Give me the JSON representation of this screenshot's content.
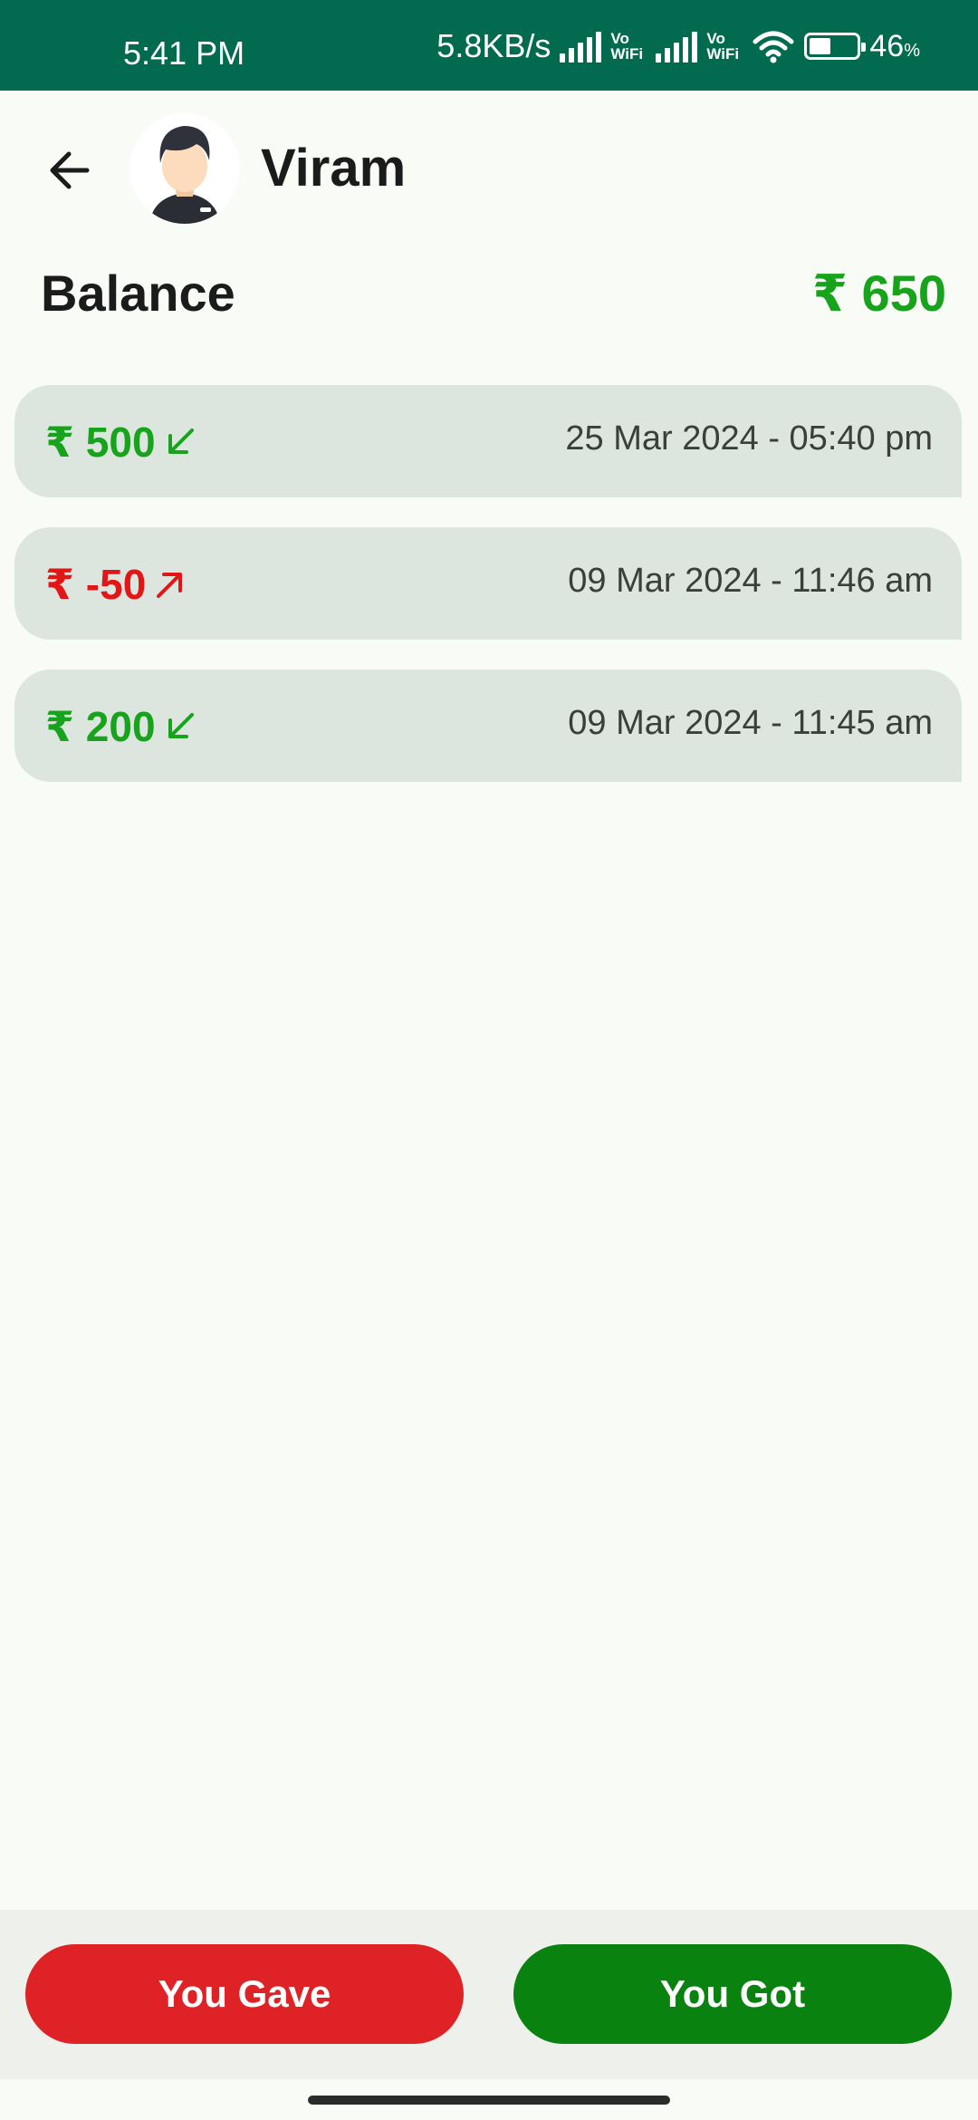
{
  "status_bar": {
    "time": "5:41 PM",
    "network_speed": "5.8KB/s",
    "vowifi_1": "Vo WiFi",
    "vowifi_2": "Vo WiFi",
    "battery_percent": "46",
    "battery_unit": "%",
    "battery_level": 0.46
  },
  "header": {
    "contact_name": "Viram",
    "back_icon": "arrow-left-icon",
    "avatar_icon": "user-avatar"
  },
  "balance": {
    "label": "Balance",
    "value": "₹ 650"
  },
  "transactions": [
    {
      "amount": "₹ 500",
      "direction": "received",
      "date": "25 Mar 2024 - 05:40 pm"
    },
    {
      "amount": "₹ -50",
      "direction": "sent",
      "date": "09 Mar 2024 - 11:46 am"
    },
    {
      "amount": "₹ 200",
      "direction": "received",
      "date": "09 Mar 2024 - 11:45 am"
    }
  ],
  "actions": {
    "gave_label": "You Gave",
    "got_label": "You Got"
  },
  "colors": {
    "status_bar": "#026b4f",
    "positive": "#17a31b",
    "negative": "#e11616",
    "gave_button": "#df2225",
    "got_button": "#0a820f",
    "row_bg": "#dce5de"
  }
}
